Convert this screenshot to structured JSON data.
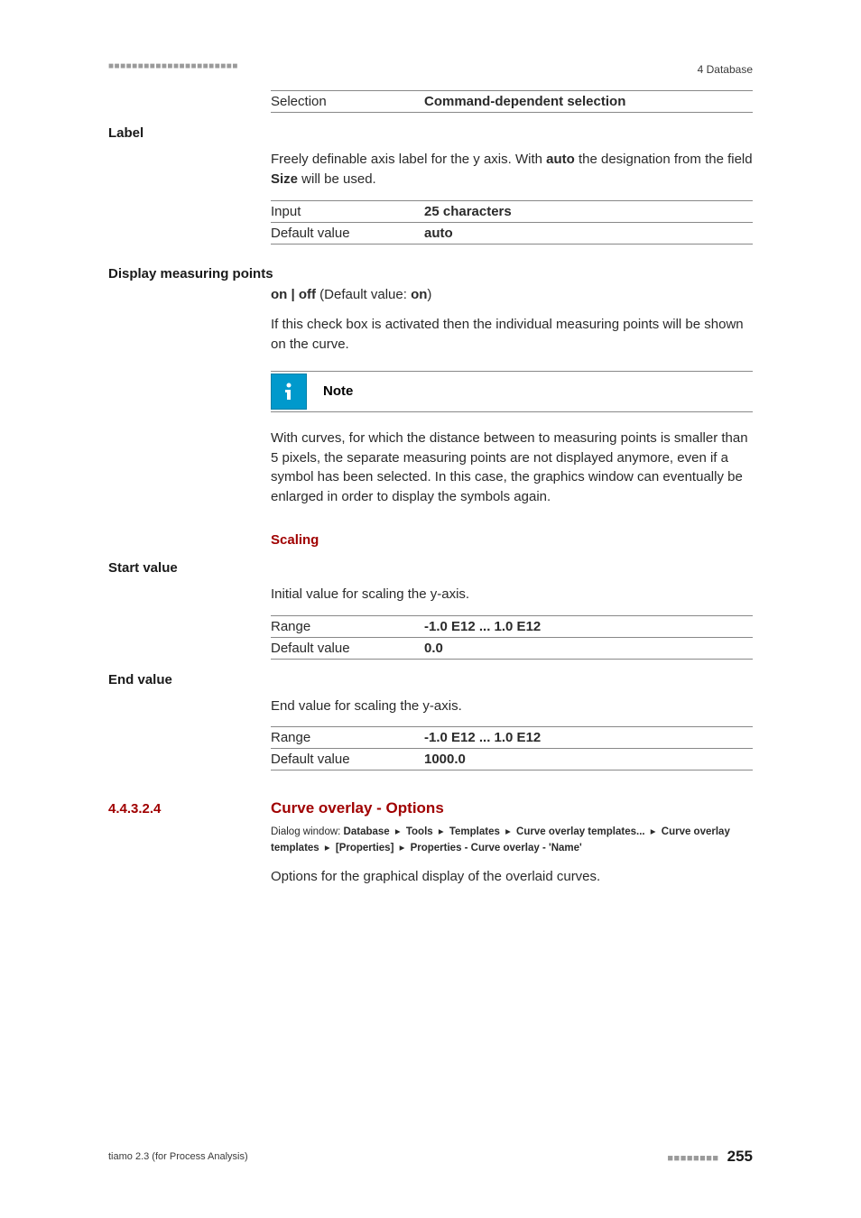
{
  "header": {
    "dashes": "■■■■■■■■■■■■■■■■■■■■■■",
    "right": "4 Database"
  },
  "rows": {
    "selection": {
      "key": "Selection",
      "val": "Command-dependent selection"
    },
    "input25": {
      "key": "Input",
      "val": "25 characters"
    },
    "default_auto": {
      "key": "Default value",
      "val": "auto"
    },
    "range": {
      "key": "Range",
      "val": "-1.0 E12 ... 1.0 E12"
    },
    "default_zero": {
      "key": "Default value",
      "val": "0.0"
    },
    "default_thousand": {
      "key": "Default value",
      "val": "1000.0"
    }
  },
  "labels": {
    "label": "Label",
    "dmp": "Display measuring points",
    "start": "Start value",
    "end": "End value"
  },
  "text": {
    "label_body_a": "Freely definable axis label for the y axis. With ",
    "label_body_b": " the designation from the field ",
    "label_body_c": " will be used.",
    "auto_bold": "auto",
    "size_bold": "Size",
    "dmp_line_a": "on | off",
    "dmp_line_b": " (Default value: ",
    "dmp_line_c": "on",
    "dmp_line_d": ")",
    "dmp_body": "If this check box is activated then the individual measuring points will be shown on the curve.",
    "note_title": "Note",
    "note_body": "With curves, for which the distance between to measuring points is smaller than 5 pixels, the separate measuring points are not displayed anymore, even if a symbol has been selected. In this case, the graphics window can eventually be enlarged in order to display the symbols again.",
    "scaling": "Scaling",
    "start_body": "Initial value for scaling the y-axis.",
    "end_body": "End value for scaling the y-axis.",
    "opt_body": "Options for the graphical display of the overlaid curves."
  },
  "subsection": {
    "num": "4.4.3.2.4",
    "title": "Curve overlay - Options",
    "dialog_prefix": "Dialog window: ",
    "path": [
      "Database",
      "Tools",
      "Templates",
      "Curve overlay templates...",
      "Curve overlay templates",
      "[Properties]",
      "Properties - Curve overlay - 'Name'"
    ]
  },
  "footer": {
    "left": "tiamo 2.3 (for Process Analysis)",
    "dashes": "■■■■■■■■",
    "page": "255"
  }
}
